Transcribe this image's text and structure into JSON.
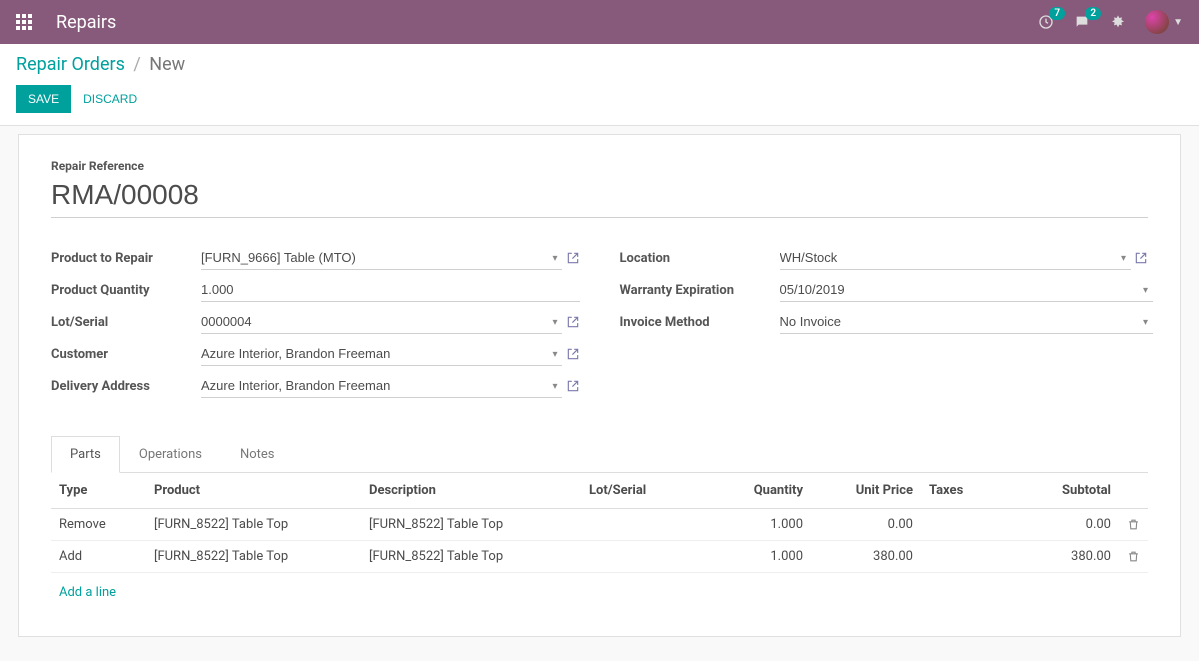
{
  "navbar": {
    "title": "Repairs",
    "activity_badge": "7",
    "messages_badge": "2"
  },
  "breadcrumb": {
    "parent": "Repair Orders",
    "current": "New"
  },
  "buttons": {
    "save": "SAVE",
    "discard": "DISCARD"
  },
  "form": {
    "ref_label": "Repair Reference",
    "ref_value": "RMA/00008",
    "left": {
      "product_label": "Product to Repair",
      "product_value": "[FURN_9666] Table (MTO)",
      "qty_label": "Product Quantity",
      "qty_value": "1.000",
      "lot_label": "Lot/Serial",
      "lot_value": "0000004",
      "customer_label": "Customer",
      "customer_value": "Azure Interior, Brandon Freeman",
      "delivery_label": "Delivery Address",
      "delivery_value": "Azure Interior, Brandon Freeman"
    },
    "right": {
      "location_label": "Location",
      "location_value": "WH/Stock",
      "warranty_label": "Warranty Expiration",
      "warranty_value": "05/10/2019",
      "invoice_label": "Invoice Method",
      "invoice_value": "No Invoice"
    }
  },
  "tabs": {
    "parts": "Parts",
    "operations": "Operations",
    "notes": "Notes"
  },
  "table": {
    "headers": {
      "type": "Type",
      "product": "Product",
      "description": "Description",
      "lot": "Lot/Serial",
      "quantity": "Quantity",
      "unit_price": "Unit Price",
      "taxes": "Taxes",
      "subtotal": "Subtotal"
    },
    "rows": [
      {
        "type": "Remove",
        "product": "[FURN_8522] Table Top",
        "description": "[FURN_8522] Table Top",
        "lot": "",
        "quantity": "1.000",
        "unit_price": "0.00",
        "taxes": "",
        "subtotal": "0.00"
      },
      {
        "type": "Add",
        "product": "[FURN_8522] Table Top",
        "description": "[FURN_8522] Table Top",
        "lot": "",
        "quantity": "1.000",
        "unit_price": "380.00",
        "taxes": "",
        "subtotal": "380.00"
      }
    ],
    "add_line": "Add a line"
  }
}
